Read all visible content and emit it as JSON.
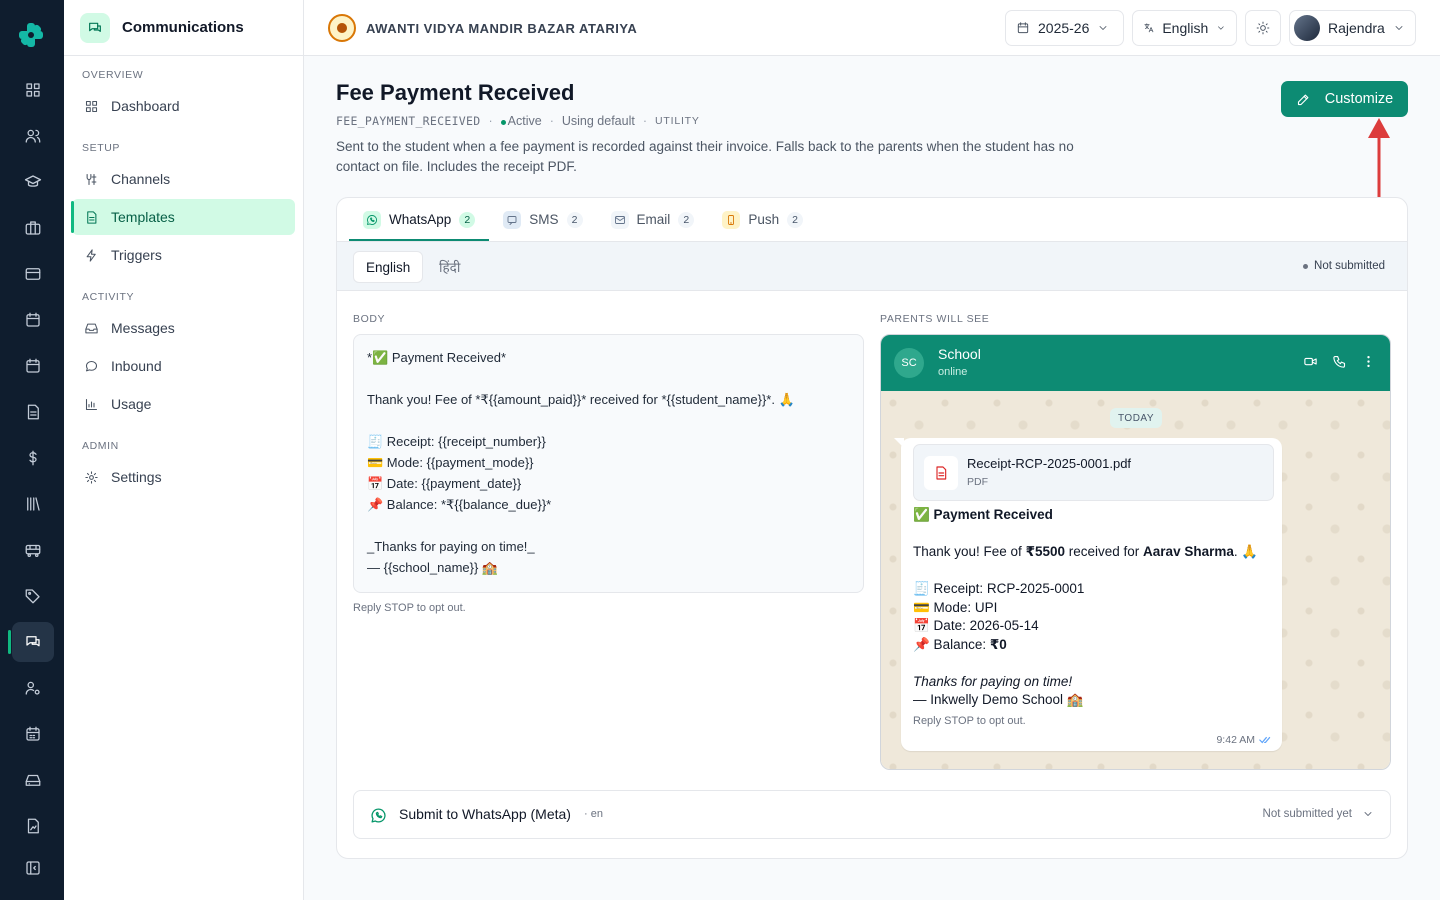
{
  "sidebar": {
    "title": "Communications",
    "sections": [
      {
        "label": "OVERVIEW"
      },
      {
        "label": "SETUP"
      },
      {
        "label": "ACTIVITY"
      },
      {
        "label": "ADMIN"
      }
    ],
    "items": [
      {
        "label": "Dashboard",
        "icon": "grid-icon"
      },
      {
        "label": "Channels",
        "icon": "channels-icon"
      },
      {
        "label": "Templates",
        "icon": "document-icon",
        "active": true
      },
      {
        "label": "Triggers",
        "icon": "lightning-icon"
      },
      {
        "label": "Messages",
        "icon": "inbox-icon"
      },
      {
        "label": "Inbound",
        "icon": "chat-bubble-icon"
      },
      {
        "label": "Usage",
        "icon": "bar-chart-icon"
      },
      {
        "label": "Settings",
        "icon": "gear-icon"
      }
    ]
  },
  "topbar": {
    "school_name": "AWANTI VIDYA MANDIR BAZAR ATARIYA",
    "year": "2025-26",
    "language": "English",
    "user": "Rajendra"
  },
  "page": {
    "title": "Fee Payment Received",
    "code": "FEE_PAYMENT_RECEIVED",
    "status": "Active",
    "source": "Using default",
    "category": "UTILITY",
    "description": "Sent to the student when a fee payment is recorded against their invoice. Falls back to the parents when the student has no contact on file. Includes the receipt PDF.",
    "customize_label": "Customize"
  },
  "tabs": [
    {
      "label": "WhatsApp",
      "count": "2",
      "icon": "whatsapp-icon"
    },
    {
      "label": "SMS",
      "count": "2",
      "icon": "sms-icon"
    },
    {
      "label": "Email",
      "count": "2",
      "icon": "mail-icon"
    },
    {
      "label": "Push",
      "count": "2",
      "icon": "push-icon"
    }
  ],
  "languages": [
    "English",
    "हिंदी"
  ],
  "submission_status": "Not submitted",
  "editor": {
    "body_label": "BODY",
    "body": "*✅ Payment Received*\n\nThank you! Fee of *₹{{amount_paid}}* received for *{{student_name}}*. 🙏\n\n🧾 Receipt: {{receipt_number}}\n💳 Mode: {{payment_mode}}\n📅 Date: {{payment_date}}\n📌 Balance: *₹{{balance_due}}*\n\n_Thanks for paying on time!_\n— {{school_name}} 🏫",
    "opt_out": "Reply STOP to opt out."
  },
  "preview": {
    "label": "PARENTS WILL SEE",
    "avatar": "SC",
    "name": "School",
    "status": "online",
    "day": "TODAY",
    "attachment_name": "Receipt-RCP-2025-0001.pdf",
    "attachment_type": "PDF",
    "heading": "✅ Payment Received",
    "thanks_prefix": "Thank you! Fee of ",
    "amount": "₹5500",
    "received_for": " received for ",
    "student": "Aarav Sharma",
    "thanks_suffix": ". 🙏",
    "receipt_line": "🧾 Receipt: RCP-2025-0001",
    "mode_line": "💳 Mode: UPI",
    "date_line": "📅 Date: 2026-05-14",
    "balance_prefix": "📌 Balance: ",
    "balance": "₹0",
    "closing": "Thanks for paying on time!",
    "signature": "— Inkwelly Demo School 🏫",
    "opt_out": "Reply STOP to opt out.",
    "time": "9:42 AM"
  },
  "submit": {
    "title": "Submit to WhatsApp (Meta)",
    "lang": "· en",
    "status": "Not submitted yet"
  },
  "colors": {
    "brand": "#0d8b73",
    "rail": "#0f1d2e",
    "active_nav": "#d1fae5",
    "arrow": "#dc3c3c"
  }
}
